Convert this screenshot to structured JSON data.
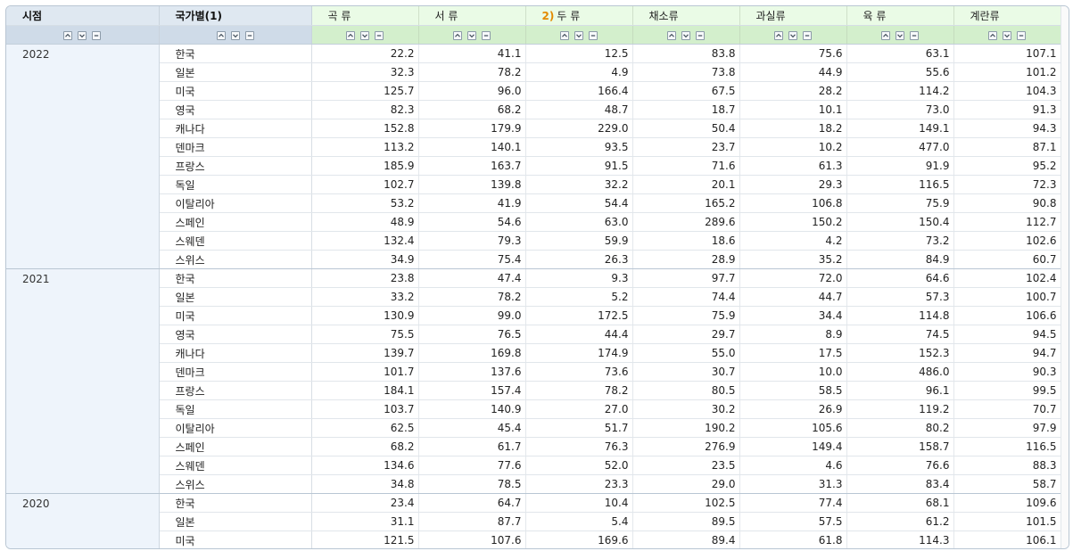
{
  "table": {
    "header": {
      "dims": [
        "시점",
        "국가별(1)"
      ],
      "items": [
        {
          "label": "곡 류",
          "note": ""
        },
        {
          "label": "서 류",
          "note": ""
        },
        {
          "label": "두 류",
          "note": "2)"
        },
        {
          "label": "채소류",
          "note": ""
        },
        {
          "label": "과실류",
          "note": ""
        },
        {
          "label": "육 류",
          "note": ""
        },
        {
          "label": "계란류",
          "note": ""
        }
      ]
    },
    "groups": [
      {
        "year": "2022",
        "rows": [
          {
            "country": "한국",
            "values": [
              "22.2",
              "41.1",
              "12.5",
              "83.8",
              "75.6",
              "63.1",
              "107.1"
            ]
          },
          {
            "country": "일본",
            "values": [
              "32.3",
              "78.2",
              "4.9",
              "73.8",
              "44.9",
              "55.6",
              "101.2"
            ]
          },
          {
            "country": "미국",
            "values": [
              "125.7",
              "96.0",
              "166.4",
              "67.5",
              "28.2",
              "114.2",
              "104.3"
            ]
          },
          {
            "country": "영국",
            "values": [
              "82.3",
              "68.2",
              "48.7",
              "18.7",
              "10.1",
              "73.0",
              "91.3"
            ]
          },
          {
            "country": "캐나다",
            "values": [
              "152.8",
              "179.9",
              "229.0",
              "50.4",
              "18.2",
              "149.1",
              "94.3"
            ]
          },
          {
            "country": "덴마크",
            "values": [
              "113.2",
              "140.1",
              "93.5",
              "23.7",
              "10.2",
              "477.0",
              "87.1"
            ]
          },
          {
            "country": "프랑스",
            "values": [
              "185.9",
              "163.7",
              "91.5",
              "71.6",
              "61.3",
              "91.9",
              "95.2"
            ]
          },
          {
            "country": "독일",
            "values": [
              "102.7",
              "139.8",
              "32.2",
              "20.1",
              "29.3",
              "116.5",
              "72.3"
            ]
          },
          {
            "country": "이탈리아",
            "values": [
              "53.2",
              "41.9",
              "54.4",
              "165.2",
              "106.8",
              "75.9",
              "90.8"
            ]
          },
          {
            "country": "스페인",
            "values": [
              "48.9",
              "54.6",
              "63.0",
              "289.6",
              "150.2",
              "150.4",
              "112.7"
            ]
          },
          {
            "country": "스웨덴",
            "values": [
              "132.4",
              "79.3",
              "59.9",
              "18.6",
              "4.2",
              "73.2",
              "102.6"
            ]
          },
          {
            "country": "스위스",
            "values": [
              "34.9",
              "75.4",
              "26.3",
              "28.9",
              "35.2",
              "84.9",
              "60.7"
            ]
          }
        ]
      },
      {
        "year": "2021",
        "rows": [
          {
            "country": "한국",
            "values": [
              "23.8",
              "47.4",
              "9.3",
              "97.7",
              "72.0",
              "64.6",
              "102.4"
            ]
          },
          {
            "country": "일본",
            "values": [
              "33.2",
              "78.2",
              "5.2",
              "74.4",
              "44.7",
              "57.3",
              "100.7"
            ]
          },
          {
            "country": "미국",
            "values": [
              "130.9",
              "99.0",
              "172.5",
              "75.9",
              "34.4",
              "114.8",
              "106.6"
            ]
          },
          {
            "country": "영국",
            "values": [
              "75.5",
              "76.5",
              "44.4",
              "29.7",
              "8.9",
              "74.5",
              "94.5"
            ]
          },
          {
            "country": "캐나다",
            "values": [
              "139.7",
              "169.8",
              "174.9",
              "55.0",
              "17.5",
              "152.3",
              "94.7"
            ]
          },
          {
            "country": "덴마크",
            "values": [
              "101.7",
              "137.6",
              "73.6",
              "30.7",
              "10.0",
              "486.0",
              "90.3"
            ]
          },
          {
            "country": "프랑스",
            "values": [
              "184.1",
              "157.4",
              "78.2",
              "80.5",
              "58.5",
              "96.1",
              "99.5"
            ]
          },
          {
            "country": "독일",
            "values": [
              "103.7",
              "140.9",
              "27.0",
              "30.2",
              "26.9",
              "119.2",
              "70.7"
            ]
          },
          {
            "country": "이탈리아",
            "values": [
              "62.5",
              "45.4",
              "51.7",
              "190.2",
              "105.6",
              "80.2",
              "97.9"
            ]
          },
          {
            "country": "스페인",
            "values": [
              "68.2",
              "61.7",
              "76.3",
              "276.9",
              "149.4",
              "158.7",
              "116.5"
            ]
          },
          {
            "country": "스웨덴",
            "values": [
              "134.6",
              "77.6",
              "52.0",
              "23.5",
              "4.6",
              "76.6",
              "88.3"
            ]
          },
          {
            "country": "스위스",
            "values": [
              "34.8",
              "78.5",
              "23.3",
              "29.0",
              "31.3",
              "83.4",
              "58.7"
            ]
          }
        ]
      },
      {
        "year": "2020",
        "rows": [
          {
            "country": "한국",
            "values": [
              "23.4",
              "64.7",
              "10.4",
              "102.5",
              "77.4",
              "68.1",
              "109.6"
            ]
          },
          {
            "country": "일본",
            "values": [
              "31.1",
              "87.7",
              "5.4",
              "89.5",
              "57.5",
              "61.2",
              "101.5"
            ]
          },
          {
            "country": "미국",
            "values": [
              "121.5",
              "107.6",
              "169.6",
              "89.4",
              "61.8",
              "114.3",
              "106.1"
            ]
          }
        ]
      }
    ]
  }
}
